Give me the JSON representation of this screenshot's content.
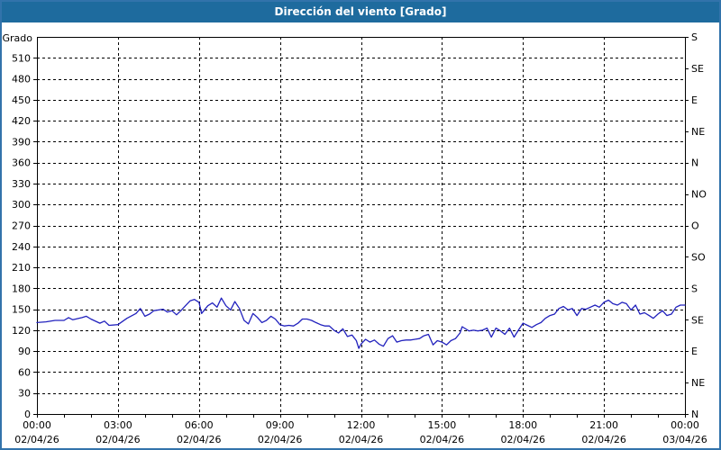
{
  "window": {
    "title": "Dirección del viento [Grado]"
  },
  "colors": {
    "titlebar_bg": "#1e6b9e",
    "title_text": "#ffffff",
    "window_border": "#3273ab",
    "plot_border": "#000000",
    "grid": "#000000",
    "line": "#2121bd",
    "text": "#000000",
    "background": "#ffffff"
  },
  "y_axis": {
    "unit_label": "Grado",
    "tick_labels": [
      "510",
      "480",
      "450",
      "420",
      "390",
      "360",
      "330",
      "300",
      "270",
      "240",
      "210",
      "180",
      "150",
      "120",
      "90",
      "60",
      "30",
      "0"
    ],
    "tick_values": [
      510,
      480,
      450,
      420,
      390,
      360,
      330,
      300,
      270,
      240,
      210,
      180,
      150,
      120,
      90,
      60,
      30,
      0
    ]
  },
  "right_axis": {
    "labels": [
      {
        "text": "S",
        "value": 540
      },
      {
        "text": "SE",
        "value": 495
      },
      {
        "text": "E",
        "value": 450
      },
      {
        "text": "NE",
        "value": 405
      },
      {
        "text": "N",
        "value": 360
      },
      {
        "text": "NO",
        "value": 315
      },
      {
        "text": "O",
        "value": 270
      },
      {
        "text": "SO",
        "value": 225
      },
      {
        "text": "S",
        "value": 180
      },
      {
        "text": "SE",
        "value": 135
      },
      {
        "text": "E",
        "value": 90
      },
      {
        "text": "NE",
        "value": 45
      },
      {
        "text": "N",
        "value": 0
      }
    ]
  },
  "x_axis": {
    "major_ticks": [
      {
        "hour": 0,
        "time": "00:00",
        "date": "02/04/26"
      },
      {
        "hour": 3,
        "time": "03:00",
        "date": "02/04/26"
      },
      {
        "hour": 6,
        "time": "06:00",
        "date": "02/04/26"
      },
      {
        "hour": 9,
        "time": "09:00",
        "date": "02/04/26"
      },
      {
        "hour": 12,
        "time": "12:00",
        "date": "02/04/26"
      },
      {
        "hour": 15,
        "time": "15:00",
        "date": "02/04/26"
      },
      {
        "hour": 18,
        "time": "18:00",
        "date": "02/04/26"
      },
      {
        "hour": 21,
        "time": "21:00",
        "date": "02/04/26"
      },
      {
        "hour": 24,
        "time": "00:00",
        "date": "03/04/26"
      }
    ],
    "minor_tick_every_hours": 1
  },
  "chart_data": {
    "type": "line",
    "title": "Dirección del viento [Grado]",
    "ylabel": "Grado",
    "ylim": [
      0,
      540
    ],
    "xlim_hours": [
      0,
      24
    ],
    "grid": "dashed, every 30 degrees horizontal, every 3 hours vertical",
    "legend_position": "none",
    "series": [
      {
        "name": "Dirección del viento",
        "x_hours": [
          0,
          0.33,
          0.67,
          1,
          1.17,
          1.33,
          1.67,
          1.83,
          2,
          2.33,
          2.5,
          2.67,
          3,
          3.33,
          3.67,
          3.83,
          4,
          4.17,
          4.33,
          4.67,
          4.83,
          5,
          5.17,
          5.33,
          5.5,
          5.67,
          5.83,
          6,
          6.1,
          6.33,
          6.5,
          6.67,
          6.83,
          7,
          7.17,
          7.33,
          7.5,
          7.67,
          7.83,
          8,
          8.17,
          8.33,
          8.5,
          8.67,
          8.83,
          9,
          9.17,
          9.33,
          9.5,
          9.67,
          9.83,
          10,
          10.17,
          10.33,
          10.5,
          10.67,
          10.83,
          11,
          11.17,
          11.33,
          11.5,
          11.67,
          11.83,
          11.92,
          12,
          12.17,
          12.33,
          12.5,
          12.67,
          12.83,
          13,
          13.17,
          13.33,
          13.5,
          13.67,
          13.83,
          14,
          14.17,
          14.33,
          14.5,
          14.67,
          14.83,
          15,
          15.17,
          15.33,
          15.5,
          15.67,
          15.75,
          16,
          16.17,
          16.33,
          16.5,
          16.67,
          16.83,
          17,
          17.17,
          17.33,
          17.5,
          17.67,
          17.83,
          18,
          18.17,
          18.33,
          18.5,
          18.67,
          18.83,
          19,
          19.17,
          19.33,
          19.5,
          19.67,
          19.83,
          20,
          20.17,
          20.33,
          20.5,
          20.67,
          20.83,
          21,
          21.17,
          21.33,
          21.5,
          21.67,
          21.83,
          22,
          22.17,
          22.33,
          22.5,
          22.67,
          22.83,
          23,
          23.17,
          23.33,
          23.5,
          23.67,
          23.83,
          24
        ],
        "values_degrees": [
          131,
          132,
          134,
          134,
          138,
          135,
          138,
          140,
          136,
          130,
          133,
          127,
          128,
          137,
          144,
          151,
          140,
          143,
          148,
          150,
          146,
          148,
          142,
          148,
          155,
          162,
          164,
          160,
          144,
          155,
          159,
          153,
          166,
          155,
          149,
          161,
          151,
          134,
          129,
          144,
          138,
          131,
          134,
          140,
          136,
          128,
          126,
          127,
          126,
          130,
          136,
          136,
          134,
          131,
          128,
          126,
          126,
          120,
          116,
          122,
          111,
          113,
          105,
          94,
          100,
          107,
          103,
          106,
          100,
          97,
          108,
          112,
          103,
          105,
          106,
          106,
          107,
          108,
          112,
          114,
          99,
          105,
          103,
          99,
          105,
          108,
          116,
          125,
          119,
          120,
          119,
          120,
          123,
          110,
          123,
          119,
          114,
          123,
          110,
          120,
          130,
          127,
          124,
          128,
          131,
          137,
          141,
          143,
          151,
          154,
          149,
          151,
          141,
          151,
          150,
          153,
          156,
          153,
          160,
          163,
          158,
          156,
          160,
          158,
          149,
          156,
          143,
          145,
          141,
          137,
          143,
          148,
          141,
          143,
          153,
          156,
          156
        ]
      }
    ]
  }
}
